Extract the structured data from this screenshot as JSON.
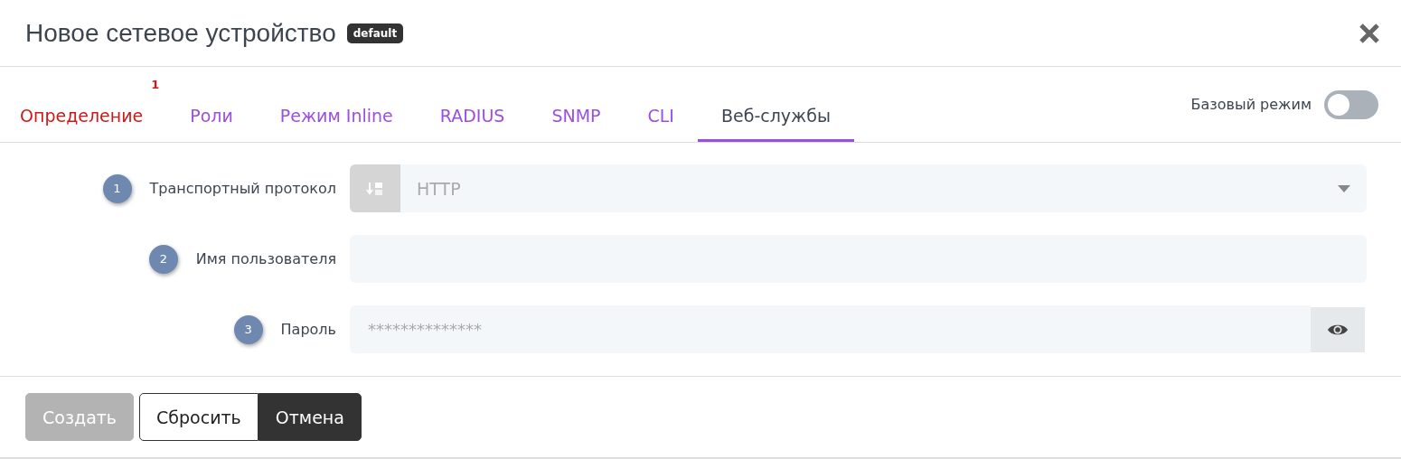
{
  "dialog": {
    "title": "Новое сетевое устройство",
    "badge": "default"
  },
  "tabs": [
    {
      "label": "Определение",
      "selected": false,
      "error": true,
      "count": "1"
    },
    {
      "label": "Роли",
      "selected": false,
      "error": false
    },
    {
      "label": "Режим Inline",
      "selected": false,
      "error": false
    },
    {
      "label": "RADIUS",
      "selected": false,
      "error": false
    },
    {
      "label": "SNMP",
      "selected": false,
      "error": false
    },
    {
      "label": "CLI",
      "selected": false,
      "error": false
    },
    {
      "label": "Веб-службы",
      "selected": true,
      "error": false
    }
  ],
  "basic_mode": {
    "label": "Базовый режим",
    "on": false
  },
  "fields": [
    {
      "step": "1",
      "label": "Транспортный протокол",
      "kind": "select",
      "value": "HTTP"
    },
    {
      "step": "2",
      "label": "Имя пользователя",
      "kind": "text"
    },
    {
      "step": "3",
      "label": "Пароль",
      "kind": "password",
      "placeholder": "**************"
    }
  ],
  "buttons": [
    {
      "label": "Создать",
      "kind": "primary",
      "disabled": true
    },
    {
      "label": "Сбросить",
      "kind": "outline",
      "disabled": false
    },
    {
      "label": "Отмена",
      "kind": "dark",
      "disabled": false
    }
  ]
}
